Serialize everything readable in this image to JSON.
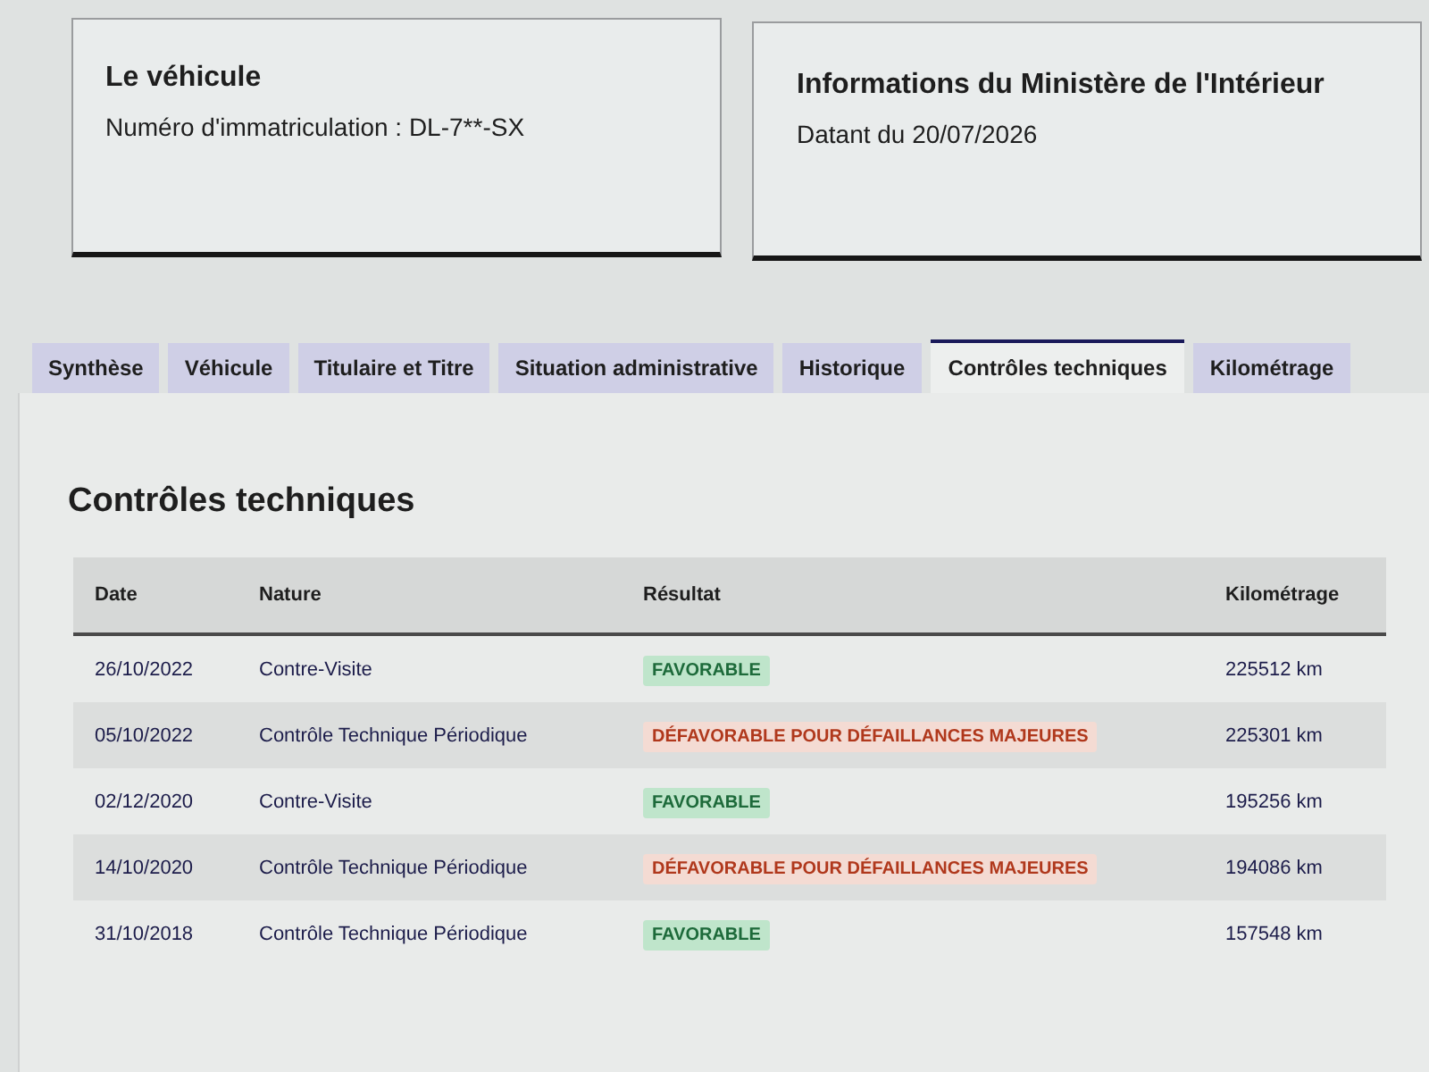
{
  "cards": [
    {
      "title": "Le véhicule",
      "text": "Numéro d'immatriculation : DL-7**-SX"
    },
    {
      "title": "Informations du Ministère de l'Intérieur",
      "text": "Datant du 20/07/2026"
    }
  ],
  "tabs": [
    {
      "label": "Synthèse",
      "selected": false
    },
    {
      "label": "Véhicule",
      "selected": false
    },
    {
      "label": "Titulaire et Titre",
      "selected": false
    },
    {
      "label": "Situation administrative",
      "selected": false
    },
    {
      "label": "Historique",
      "selected": false
    },
    {
      "label": "Contrôles techniques",
      "selected": true
    },
    {
      "label": "Kilométrage",
      "selected": false
    }
  ],
  "section": {
    "title": "Contrôles techniques"
  },
  "table": {
    "columns": [
      "Date",
      "Nature",
      "Résultat",
      "Kilométrage"
    ],
    "rows": [
      {
        "date": "26/10/2022",
        "nature": "Contre-Visite",
        "result": {
          "text": "FAVORABLE",
          "kind": "favorable"
        },
        "mileage": "225512 km"
      },
      {
        "date": "05/10/2022",
        "nature": "Contrôle Technique Périodique",
        "result": {
          "text": "DÉFAVORABLE POUR DÉFAILLANCES MAJEURES",
          "kind": "unfavorable"
        },
        "mileage": "225301 km"
      },
      {
        "date": "02/12/2020",
        "nature": "Contre-Visite",
        "result": {
          "text": "FAVORABLE",
          "kind": "favorable"
        },
        "mileage": "195256 km"
      },
      {
        "date": "14/10/2020",
        "nature": "Contrôle Technique Périodique",
        "result": {
          "text": "DÉFAVORABLE POUR DÉFAILLANCES MAJEURES",
          "kind": "unfavorable"
        },
        "mileage": "194086 km"
      },
      {
        "date": "31/10/2018",
        "nature": "Contrôle Technique Périodique",
        "result": {
          "text": "FAVORABLE",
          "kind": "favorable"
        },
        "mileage": "157548 km"
      }
    ]
  }
}
